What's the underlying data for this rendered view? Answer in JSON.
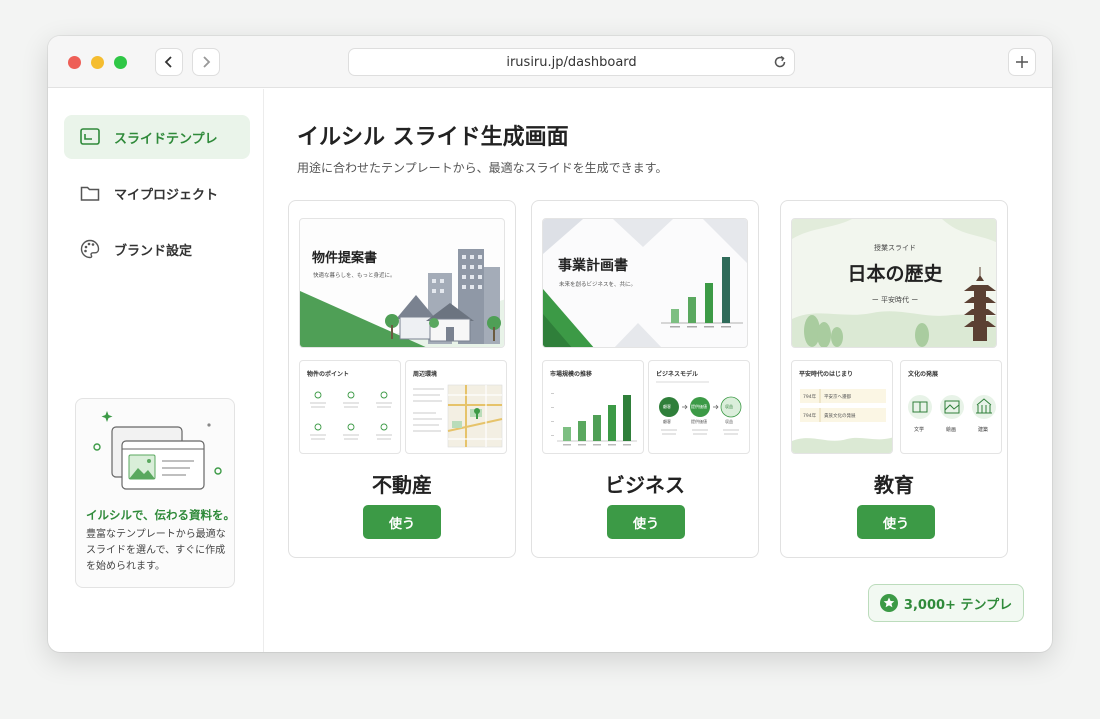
{
  "browser": {
    "url": "irusiru.jp/dashboard"
  },
  "colors": {
    "accent": "#3c9a46",
    "accent_light": "#eaf4ea",
    "text": "#222222"
  },
  "sidebar": {
    "items": [
      {
        "label": "スライドテンプレ",
        "icon": "slides-icon",
        "active": true
      },
      {
        "label": "マイプロジェクト",
        "icon": "folder-icon",
        "active": false
      },
      {
        "label": "ブランド設定",
        "icon": "palette-icon",
        "active": false
      }
    ],
    "promo": {
      "title": "イルシルで、伝わる資料を。",
      "description": "豊富なテンプレートから最適なスライドを選んで、すぐに作成を始められます。"
    }
  },
  "main": {
    "title": "イルシル スライド生成画面",
    "subtitle": "用途に合わせたテンプレートから、最適なスライドを生成できます。",
    "use_label": "使う",
    "cards": [
      {
        "category": "不動産",
        "thumb_title": "物件提案書",
        "thumb_subtitle": "快適な暮らしを、もっと身近に。",
        "mini1_title": "物件のポイント",
        "mini2_title": "周辺環境"
      },
      {
        "category": "ビジネス",
        "thumb_title": "事業計画書",
        "thumb_subtitle": "未来を創るビジネスを、共に。",
        "mini1_title": "市場規模の推移",
        "mini2_title": "ビジネスモデル",
        "flow": [
          "顧客",
          "提供価値",
          "収益"
        ]
      },
      {
        "category": "教育",
        "thumb_kicker": "授業スライド",
        "thumb_title": "日本の歴史",
        "thumb_subtitle": "ー 平安時代 ー",
        "mini1_title": "平安時代のはじまり",
        "timeline": [
          {
            "year": "794年",
            "event": "平安京へ遷都"
          },
          {
            "year": "794年",
            "event": "貴族文化の発展"
          }
        ],
        "mini2_title": "文化の発展",
        "culture": [
          "文学",
          "絵画",
          "建築"
        ]
      }
    ],
    "badge": "3,000+ テンプレ"
  }
}
